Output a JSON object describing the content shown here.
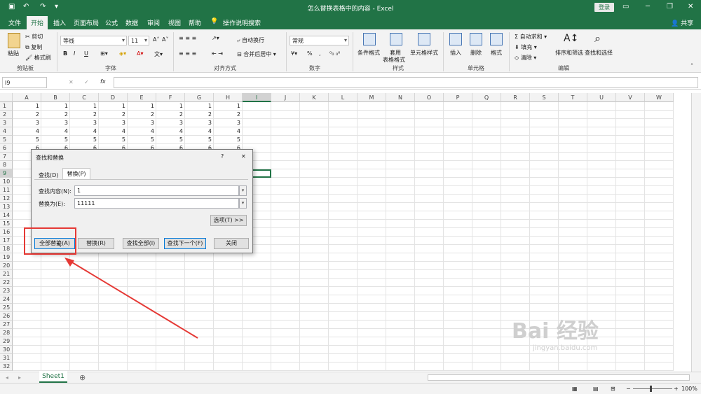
{
  "titlebar": {
    "title": "怎么替换表格中的内容 - Excel",
    "login": "登录",
    "share": "共享"
  },
  "tabs": [
    "文件",
    "开始",
    "插入",
    "页面布局",
    "公式",
    "数据",
    "审阅",
    "视图",
    "帮助"
  ],
  "tell_me": "操作说明搜索",
  "ribbon": {
    "clipboard": {
      "paste": "粘贴",
      "cut": "剪切",
      "copy": "复制",
      "painter": "格式刷",
      "label": "剪贴板"
    },
    "font": {
      "name": "等线",
      "size": "11",
      "label": "字体",
      "bold": "B",
      "italic": "I",
      "underline": "U"
    },
    "align": {
      "wrap": "自动换行",
      "merge": "合并后居中",
      "label": "对齐方式"
    },
    "number": {
      "format": "常规",
      "label": "数字",
      "percent": "%",
      "comma": ","
    },
    "styles": {
      "cond": "条件格式",
      "table1": "套用",
      "table2": "表格格式",
      "cell": "单元格样式",
      "label": "样式"
    },
    "cells": {
      "insert": "插入",
      "delete": "删除",
      "format": "格式",
      "label": "单元格"
    },
    "edit": {
      "autosum": "自动求和",
      "fill": "填充",
      "clear": "清除",
      "sort": "排序和筛选",
      "find": "查找和选择",
      "label": "编辑"
    }
  },
  "namebox": "I9",
  "fx": "fx",
  "columns": [
    "A",
    "B",
    "C",
    "D",
    "E",
    "F",
    "G",
    "H",
    "I",
    "J",
    "K",
    "L",
    "M",
    "N",
    "O",
    "P",
    "Q",
    "R",
    "S",
    "T",
    "U",
    "V",
    "W"
  ],
  "rows": [
    "1",
    "2",
    "3",
    "4",
    "5",
    "6",
    "7",
    "8",
    "9",
    "10",
    "11",
    "12",
    "13",
    "14",
    "15",
    "16",
    "17",
    "18",
    "19",
    "20",
    "21",
    "22",
    "23",
    "24",
    "25",
    "26",
    "27",
    "28",
    "29",
    "30",
    "31",
    "32"
  ],
  "cells": [
    [
      "1",
      "1",
      "1",
      "1",
      "1",
      "1",
      "1",
      "1"
    ],
    [
      "2",
      "2",
      "2",
      "2",
      "2",
      "2",
      "2",
      "2"
    ],
    [
      "3",
      "3",
      "3",
      "3",
      "3",
      "3",
      "3",
      "3"
    ],
    [
      "4",
      "4",
      "4",
      "4",
      "4",
      "4",
      "4",
      "4"
    ],
    [
      "5",
      "5",
      "5",
      "5",
      "5",
      "5",
      "5",
      "5"
    ],
    [
      "6",
      "6",
      "6",
      "6",
      "6",
      "6",
      "6",
      "6"
    ]
  ],
  "dialog": {
    "title": "查找和替换",
    "help": "?",
    "close": "✕",
    "tab_find": "查找(D)",
    "tab_replace": "替换(P)",
    "find_label": "查找内容(N):",
    "find_value": "1",
    "replace_label": "替换为(E):",
    "replace_value": "11111",
    "options": "选项(T) >>",
    "replace_all": "全部替换(A)",
    "replace": "替换(R)",
    "find_all": "查找全部(I)",
    "find_next": "查找下一个(F)",
    "close_btn": "关闭"
  },
  "sheet": "Sheet1",
  "zoom": "100%",
  "watermark": {
    "main": "Bai 经验",
    "sub": "jingyan.baidu.com"
  },
  "colors": {
    "excel_green": "#217346",
    "highlight_red": "#e53935"
  }
}
